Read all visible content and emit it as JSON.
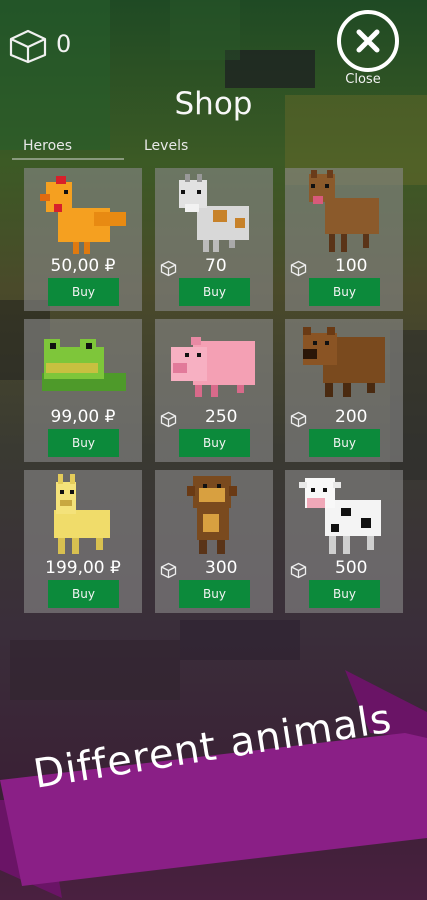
{
  "header": {
    "currency_count": "0",
    "close_label": "Close",
    "title": "Shop"
  },
  "tabs": [
    {
      "label": "Heroes"
    },
    {
      "label": "Levels"
    }
  ],
  "items": [
    {
      "animal": "chicken",
      "price": "50,00 ₽",
      "price_type": "money",
      "buy_label": "Buy"
    },
    {
      "animal": "goat",
      "price": "70",
      "price_type": "cubes",
      "buy_label": "Buy"
    },
    {
      "animal": "deer",
      "price": "100",
      "price_type": "cubes",
      "buy_label": "Buy"
    },
    {
      "animal": "frog",
      "price": "99,00 ₽",
      "price_type": "money",
      "buy_label": "Buy"
    },
    {
      "animal": "pig",
      "price": "250",
      "price_type": "cubes",
      "buy_label": "Buy"
    },
    {
      "animal": "bear",
      "price": "200",
      "price_type": "cubes",
      "buy_label": "Buy"
    },
    {
      "animal": "llama",
      "price": "199,00 ₽",
      "price_type": "money",
      "buy_label": "Buy"
    },
    {
      "animal": "monkey",
      "price": "300",
      "price_type": "cubes",
      "buy_label": "Buy"
    },
    {
      "animal": "cow",
      "price": "500",
      "price_type": "cubes",
      "buy_label": "Buy"
    }
  ],
  "banner": {
    "text": "Different animals",
    "color": "#8a1f86"
  }
}
